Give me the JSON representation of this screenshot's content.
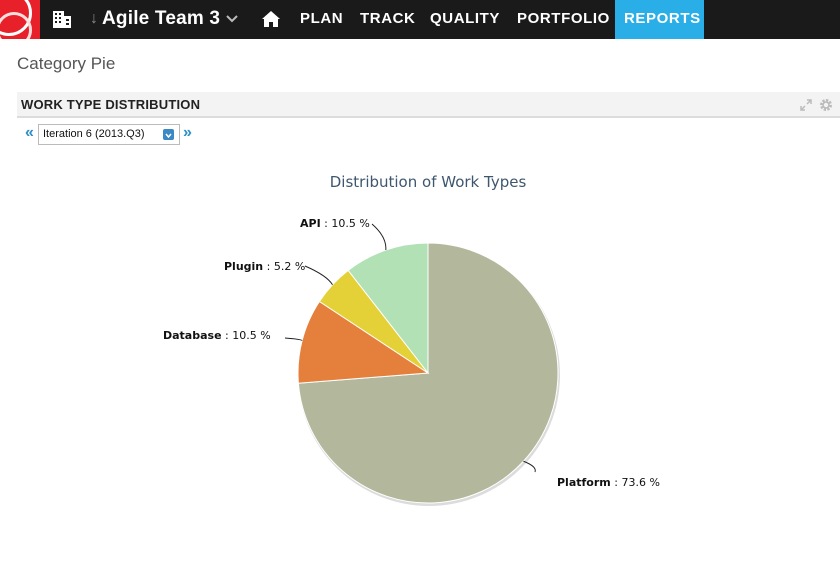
{
  "app": {
    "team_name": "Agile Team 3"
  },
  "nav": {
    "items": [
      "PLAN",
      "TRACK",
      "QUALITY",
      "PORTFOLIO",
      "REPORTS"
    ],
    "active": "REPORTS"
  },
  "page": {
    "title": "Category Pie"
  },
  "widget": {
    "title": "WORK TYPE DISTRIBUTION",
    "iteration": "Iteration 6 (2013.Q3)",
    "prev_label": "«",
    "next_label": "»"
  },
  "colors": {
    "topbar": "#1a1a1a",
    "active_tab": "#2aaee8",
    "logo": "#e8202a"
  },
  "chart_data": {
    "type": "pie",
    "title": "Distribution of Work Types",
    "slices": [
      {
        "name": "Platform",
        "value": 73.6,
        "color": "#b3b89c"
      },
      {
        "name": "Database",
        "value": 10.5,
        "color": "#e57f3c"
      },
      {
        "name": "Plugin",
        "value": 5.2,
        "color": "#e4d138"
      },
      {
        "name": "API",
        "value": 10.5,
        "color": "#b2e1b6"
      }
    ],
    "unit_suffix": " %"
  }
}
